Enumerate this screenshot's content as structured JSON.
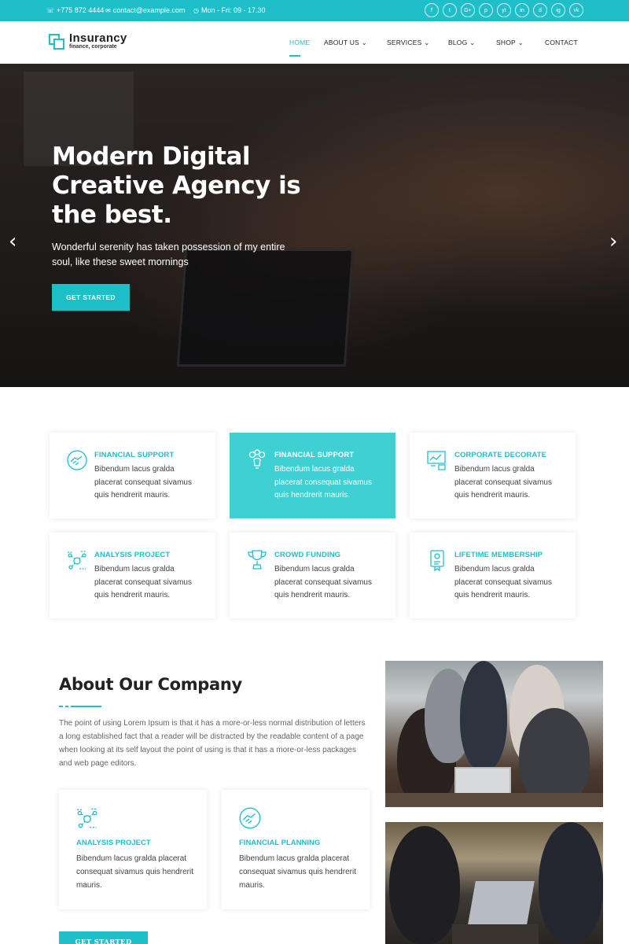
{
  "topbar": {
    "phone": "+775 872 4444",
    "email": "contact@example.com",
    "hours": "Mon - Fri: 09 - 17.30",
    "socials": [
      "f",
      "t",
      "G+",
      "p",
      "yt",
      "in",
      "d",
      "ig",
      "vk"
    ]
  },
  "brand": {
    "name": "Insurancy",
    "tagline": "finance, corporate"
  },
  "nav": {
    "items": [
      {
        "label": "HOME",
        "active": true
      },
      {
        "label": "ABOUT US",
        "dropdown": true
      },
      {
        "label": "SERVICES",
        "dropdown": true
      },
      {
        "label": "BLOG",
        "dropdown": true
      },
      {
        "label": "SHOP",
        "dropdown": true
      },
      {
        "label": "CONTACT"
      }
    ]
  },
  "hero": {
    "title": "Modern Digital Creative Agency is the best.",
    "subtitle": "Wonderful serenity has taken possession of my entire soul, like these sweet mornings",
    "cta": "GET STARTED",
    "prev_icon": "chevron-left-icon",
    "next_icon": "chevron-right-icon"
  },
  "services": [
    {
      "title": "FINANCIAL SUPPORT",
      "desc": "Bibendum lacus gralda placerat consequat sivamus quis hendrerit mauris.",
      "icon": "handshake-icon"
    },
    {
      "title": "FINANCIAL SUPPORT",
      "desc": "Bibendum lacus gralda placerat consequat sivamus quis hendrerit mauris.",
      "icon": "idea-people-icon",
      "highlight": true
    },
    {
      "title": "CORPORATE DECORATE",
      "desc": "Bibendum lacus gralda placerat consequat sivamus quis hendrerit mauris.",
      "icon": "presentation-board-icon"
    },
    {
      "title": "ANALYSIS PROJECT",
      "desc": "Bibendum lacus gralda placerat consequat sivamus quis hendrerit mauris.",
      "icon": "network-analysis-icon"
    },
    {
      "title": "CROWD FUNDING",
      "desc": "Bibendum lacus gralda placerat consequat sivamus quis hendrerit mauris.",
      "icon": "trophy-icon"
    },
    {
      "title": "LIFETIME MEMBERSHIP",
      "desc": "Bibendum lacus gralda placerat consequat sivamus quis hendrerit mauris.",
      "icon": "member-card-icon"
    }
  ],
  "about": {
    "title": "About Our Company",
    "text": "The point of using Lorem Ipsum is that it has a more-or-less normal distribution of letters a long established fact that a reader will be distracted by the readable content of a page when looking at its self layout the point of using is that it has a more-or-less packages and web page editors.",
    "features": [
      {
        "title": "ANALYSIS PROJECT",
        "desc": "Bibendum lacus gralda placerat consequat sivamus quis hendrerit mauris.",
        "icon": "network-analysis-icon"
      },
      {
        "title": "FINANCIAL PLANNING",
        "desc": "Bibendum lacus gralda placerat consequat sivamus quis hendrerit mauris.",
        "icon": "handshake-icon"
      }
    ],
    "cta": "GET STARTED"
  },
  "colors": {
    "accent": "#1fbfc9",
    "highlight_card": "#3fd0d4",
    "heading": "#222222"
  }
}
